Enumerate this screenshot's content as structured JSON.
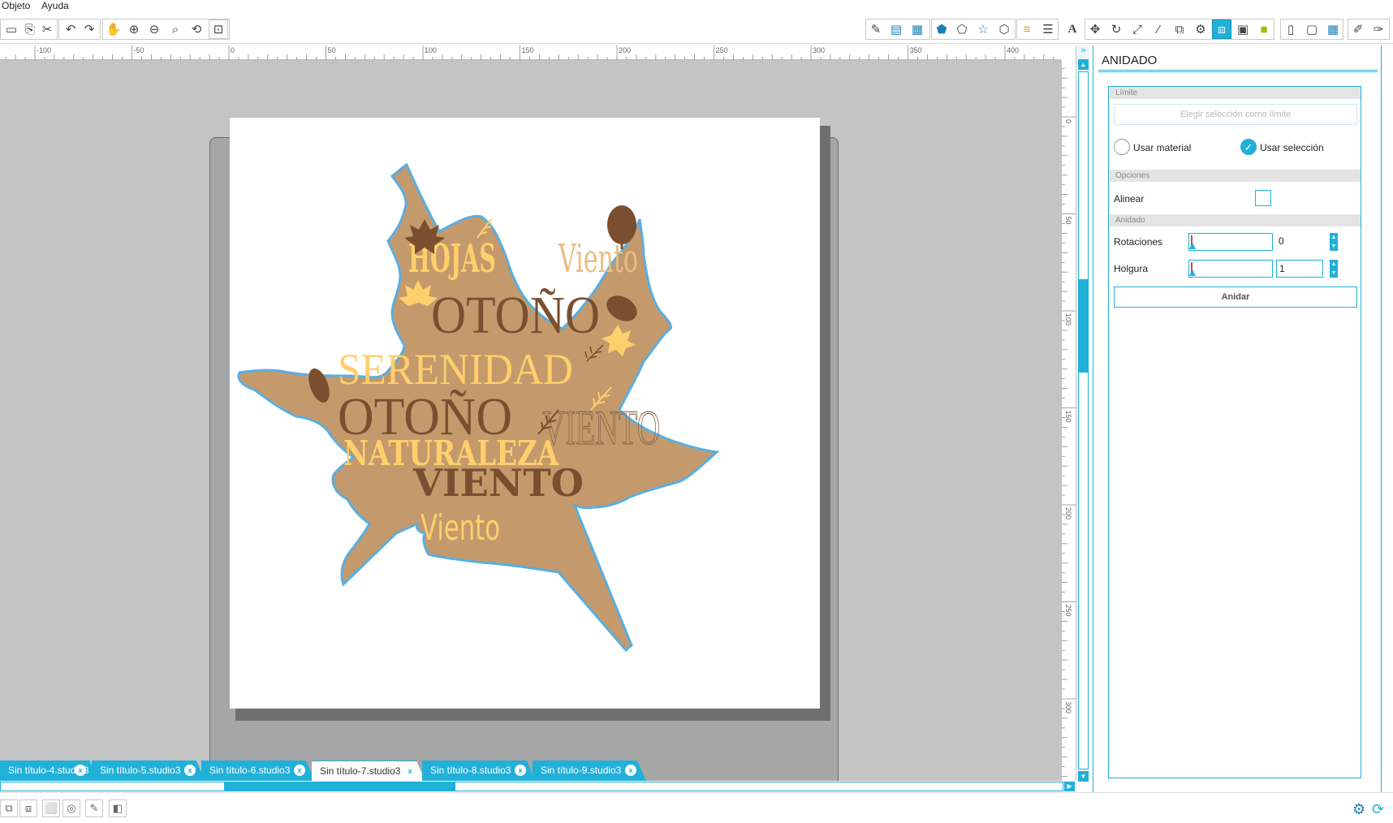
{
  "menu": {
    "items": [
      "Objeto",
      "Ayuda"
    ]
  },
  "toolbar": {
    "left_icons": [
      "new-icon",
      "open-icon",
      "cut-icon",
      "undo-icon",
      "redo-icon",
      "hand-icon",
      "zoom-in-icon",
      "zoom-out-icon",
      "zoom-select-icon",
      "zoom-drag-icon",
      "fit-icon"
    ],
    "right_icons": [
      "draw-icon",
      "page-icon",
      "grid-icon",
      "fill-icon",
      "pattern-icon",
      "shape-icon",
      "offset-icon",
      "line-color-icon",
      "line-style-icon",
      "text-icon",
      "align-icon",
      "rotate-icon",
      "scale-icon",
      "knife-icon",
      "mirror-icon",
      "trace-icon",
      "nest-icon",
      "image-icon",
      "library-icon",
      "send-icon",
      "store-icon",
      "panel-icon",
      "design-icon",
      "cut-send-icon"
    ]
  },
  "ruler": {
    "top_labels": [
      "-100",
      "-50",
      "0",
      "50",
      "100",
      "150",
      "200",
      "250",
      "300",
      "350",
      "400"
    ],
    "side_labels": [
      "0",
      "50",
      "100",
      "150",
      "200",
      "250",
      "300"
    ]
  },
  "design": {
    "words": [
      "HOJAS",
      "Viento",
      "OTOÑO",
      "SERENIDAD",
      "OTOÑO",
      "VIENTO",
      "NATURALEZA",
      "VIENTO",
      "Viento"
    ],
    "leaf_fill": "#c49a6c",
    "leaf_stroke": "#5aaee0",
    "dark_brown": "#7a4f30",
    "light_yellow": "#ffcf6b"
  },
  "tabs": [
    {
      "label": "Sin título-4.studio3"
    },
    {
      "label": "Sin título-5.studio3"
    },
    {
      "label": "Sin título-6.studio3"
    },
    {
      "label": "Sin título-7.studio3"
    },
    {
      "label": "Sin título-8.studio3"
    },
    {
      "label": "Sin título-9.studio3"
    }
  ],
  "tab_close": "x",
  "panel": {
    "title": "ANIDADO",
    "limite": {
      "header": "Límite",
      "button": "Elegir selección como límite",
      "radio_material": "Usar material",
      "radio_seleccion": "Usar selección"
    },
    "opciones": {
      "header": "Opciones",
      "alinear": "Alinear"
    },
    "anidado": {
      "header": "Anidado",
      "rotaciones_label": "Rotaciones",
      "rotaciones_value": "0",
      "holgura_label": "Holgura",
      "holgura_value": "1",
      "button": "Anidar"
    }
  },
  "accent": "#21b0d8"
}
